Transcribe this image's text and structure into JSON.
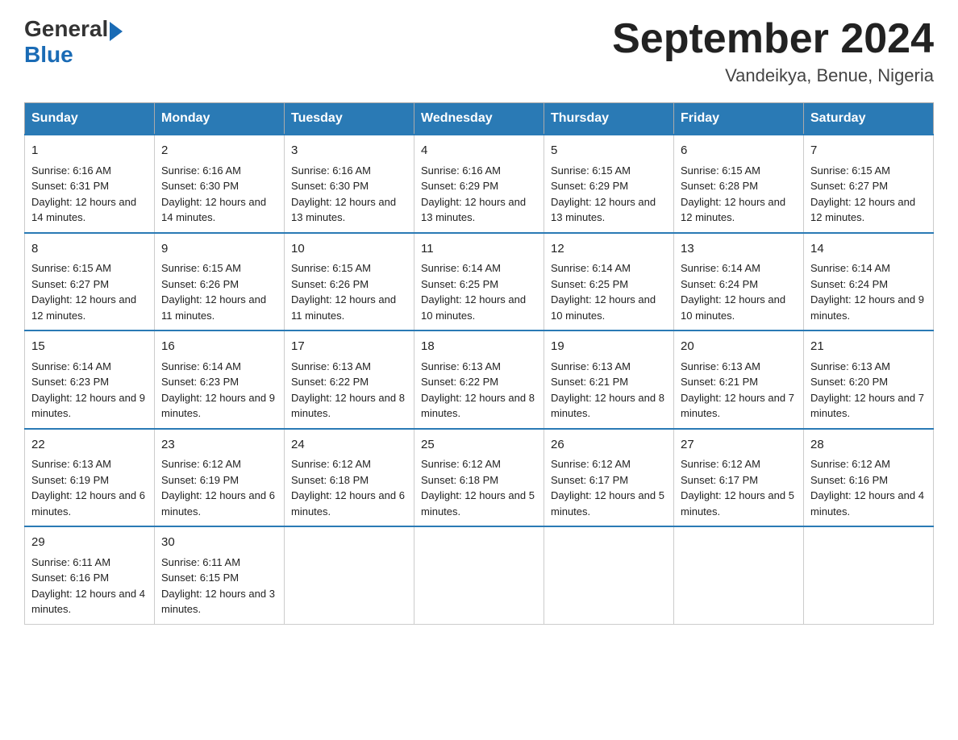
{
  "header": {
    "logo_general": "General",
    "logo_blue": "Blue",
    "title": "September 2024",
    "subtitle": "Vandeikya, Benue, Nigeria"
  },
  "days_of_week": [
    "Sunday",
    "Monday",
    "Tuesday",
    "Wednesday",
    "Thursday",
    "Friday",
    "Saturday"
  ],
  "weeks": [
    [
      {
        "day": "1",
        "sunrise": "Sunrise: 6:16 AM",
        "sunset": "Sunset: 6:31 PM",
        "daylight": "Daylight: 12 hours and 14 minutes."
      },
      {
        "day": "2",
        "sunrise": "Sunrise: 6:16 AM",
        "sunset": "Sunset: 6:30 PM",
        "daylight": "Daylight: 12 hours and 14 minutes."
      },
      {
        "day": "3",
        "sunrise": "Sunrise: 6:16 AM",
        "sunset": "Sunset: 6:30 PM",
        "daylight": "Daylight: 12 hours and 13 minutes."
      },
      {
        "day": "4",
        "sunrise": "Sunrise: 6:16 AM",
        "sunset": "Sunset: 6:29 PM",
        "daylight": "Daylight: 12 hours and 13 minutes."
      },
      {
        "day": "5",
        "sunrise": "Sunrise: 6:15 AM",
        "sunset": "Sunset: 6:29 PM",
        "daylight": "Daylight: 12 hours and 13 minutes."
      },
      {
        "day": "6",
        "sunrise": "Sunrise: 6:15 AM",
        "sunset": "Sunset: 6:28 PM",
        "daylight": "Daylight: 12 hours and 12 minutes."
      },
      {
        "day": "7",
        "sunrise": "Sunrise: 6:15 AM",
        "sunset": "Sunset: 6:27 PM",
        "daylight": "Daylight: 12 hours and 12 minutes."
      }
    ],
    [
      {
        "day": "8",
        "sunrise": "Sunrise: 6:15 AM",
        "sunset": "Sunset: 6:27 PM",
        "daylight": "Daylight: 12 hours and 12 minutes."
      },
      {
        "day": "9",
        "sunrise": "Sunrise: 6:15 AM",
        "sunset": "Sunset: 6:26 PM",
        "daylight": "Daylight: 12 hours and 11 minutes."
      },
      {
        "day": "10",
        "sunrise": "Sunrise: 6:15 AM",
        "sunset": "Sunset: 6:26 PM",
        "daylight": "Daylight: 12 hours and 11 minutes."
      },
      {
        "day": "11",
        "sunrise": "Sunrise: 6:14 AM",
        "sunset": "Sunset: 6:25 PM",
        "daylight": "Daylight: 12 hours and 10 minutes."
      },
      {
        "day": "12",
        "sunrise": "Sunrise: 6:14 AM",
        "sunset": "Sunset: 6:25 PM",
        "daylight": "Daylight: 12 hours and 10 minutes."
      },
      {
        "day": "13",
        "sunrise": "Sunrise: 6:14 AM",
        "sunset": "Sunset: 6:24 PM",
        "daylight": "Daylight: 12 hours and 10 minutes."
      },
      {
        "day": "14",
        "sunrise": "Sunrise: 6:14 AM",
        "sunset": "Sunset: 6:24 PM",
        "daylight": "Daylight: 12 hours and 9 minutes."
      }
    ],
    [
      {
        "day": "15",
        "sunrise": "Sunrise: 6:14 AM",
        "sunset": "Sunset: 6:23 PM",
        "daylight": "Daylight: 12 hours and 9 minutes."
      },
      {
        "day": "16",
        "sunrise": "Sunrise: 6:14 AM",
        "sunset": "Sunset: 6:23 PM",
        "daylight": "Daylight: 12 hours and 9 minutes."
      },
      {
        "day": "17",
        "sunrise": "Sunrise: 6:13 AM",
        "sunset": "Sunset: 6:22 PM",
        "daylight": "Daylight: 12 hours and 8 minutes."
      },
      {
        "day": "18",
        "sunrise": "Sunrise: 6:13 AM",
        "sunset": "Sunset: 6:22 PM",
        "daylight": "Daylight: 12 hours and 8 minutes."
      },
      {
        "day": "19",
        "sunrise": "Sunrise: 6:13 AM",
        "sunset": "Sunset: 6:21 PM",
        "daylight": "Daylight: 12 hours and 8 minutes."
      },
      {
        "day": "20",
        "sunrise": "Sunrise: 6:13 AM",
        "sunset": "Sunset: 6:21 PM",
        "daylight": "Daylight: 12 hours and 7 minutes."
      },
      {
        "day": "21",
        "sunrise": "Sunrise: 6:13 AM",
        "sunset": "Sunset: 6:20 PM",
        "daylight": "Daylight: 12 hours and 7 minutes."
      }
    ],
    [
      {
        "day": "22",
        "sunrise": "Sunrise: 6:13 AM",
        "sunset": "Sunset: 6:19 PM",
        "daylight": "Daylight: 12 hours and 6 minutes."
      },
      {
        "day": "23",
        "sunrise": "Sunrise: 6:12 AM",
        "sunset": "Sunset: 6:19 PM",
        "daylight": "Daylight: 12 hours and 6 minutes."
      },
      {
        "day": "24",
        "sunrise": "Sunrise: 6:12 AM",
        "sunset": "Sunset: 6:18 PM",
        "daylight": "Daylight: 12 hours and 6 minutes."
      },
      {
        "day": "25",
        "sunrise": "Sunrise: 6:12 AM",
        "sunset": "Sunset: 6:18 PM",
        "daylight": "Daylight: 12 hours and 5 minutes."
      },
      {
        "day": "26",
        "sunrise": "Sunrise: 6:12 AM",
        "sunset": "Sunset: 6:17 PM",
        "daylight": "Daylight: 12 hours and 5 minutes."
      },
      {
        "day": "27",
        "sunrise": "Sunrise: 6:12 AM",
        "sunset": "Sunset: 6:17 PM",
        "daylight": "Daylight: 12 hours and 5 minutes."
      },
      {
        "day": "28",
        "sunrise": "Sunrise: 6:12 AM",
        "sunset": "Sunset: 6:16 PM",
        "daylight": "Daylight: 12 hours and 4 minutes."
      }
    ],
    [
      {
        "day": "29",
        "sunrise": "Sunrise: 6:11 AM",
        "sunset": "Sunset: 6:16 PM",
        "daylight": "Daylight: 12 hours and 4 minutes."
      },
      {
        "day": "30",
        "sunrise": "Sunrise: 6:11 AM",
        "sunset": "Sunset: 6:15 PM",
        "daylight": "Daylight: 12 hours and 3 minutes."
      },
      null,
      null,
      null,
      null,
      null
    ]
  ]
}
